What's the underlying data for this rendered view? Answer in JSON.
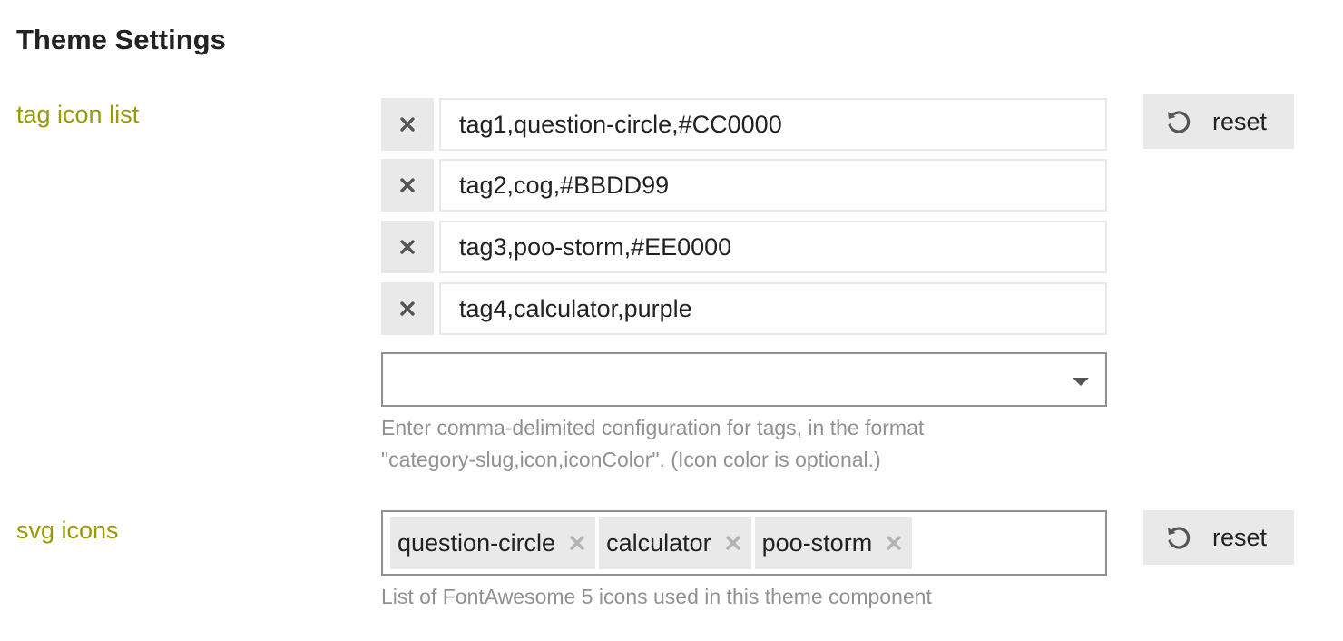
{
  "page": {
    "title": "Theme Settings"
  },
  "settings": {
    "tag_icon_list": {
      "label": "tag icon list",
      "values": [
        "tag1,question-circle,#CC0000",
        "tag2,cog,#BBDD99",
        "tag3,poo-storm,#EE0000",
        "tag4,calculator,purple"
      ],
      "add_select_value": "",
      "help_line1": "Enter comma-delimited configuration for tags, in the format",
      "help_line2": "\"category-slug,icon,iconColor\". (Icon color is optional.)",
      "reset_label": "reset"
    },
    "svg_icons": {
      "label": "svg icons",
      "chips": [
        "question-circle",
        "calculator",
        "poo-storm"
      ],
      "help": "List of FontAwesome 5 icons used in this theme component",
      "reset_label": "reset"
    }
  },
  "icons": {
    "remove": "times-icon",
    "reset": "undo-icon",
    "dropdown": "caret-down-icon",
    "chip_remove": "times-icon"
  },
  "colors": {
    "label": "#9a9a00",
    "button_bg": "#e9e9e9",
    "border": "#919191",
    "help_text": "#919191",
    "text": "#222222"
  }
}
